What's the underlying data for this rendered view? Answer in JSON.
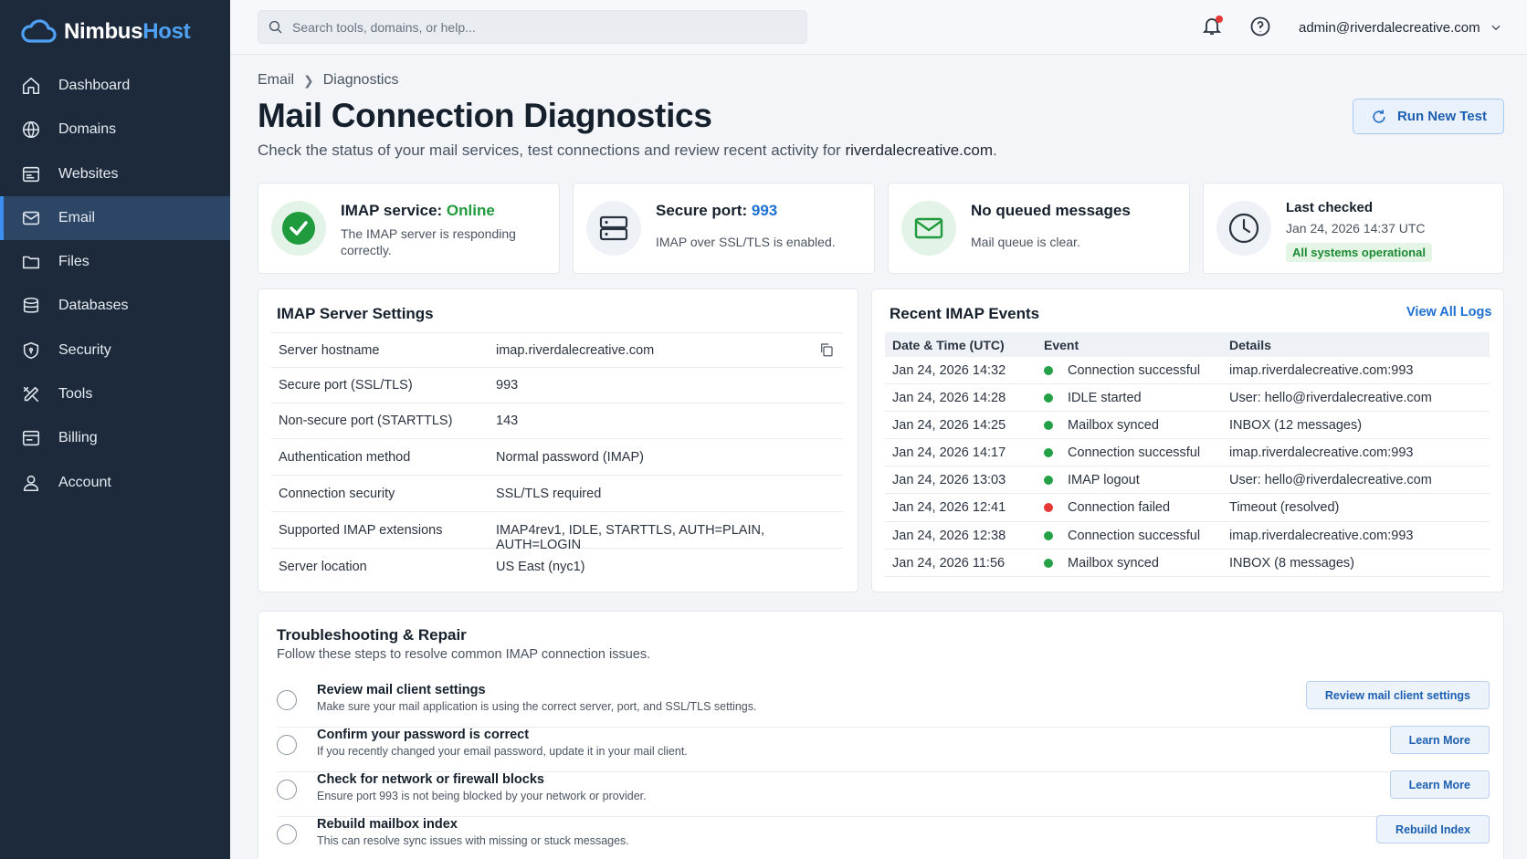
{
  "brand": {
    "name_a": "Nimbus",
    "name_b": "Host"
  },
  "sidebar": {
    "items": [
      {
        "label": "Dashboard",
        "icon": "home-icon"
      },
      {
        "label": "Domains",
        "icon": "globe-icon"
      },
      {
        "label": "Websites",
        "icon": "browser-window-icon"
      },
      {
        "label": "Email",
        "icon": "mail-icon",
        "active": true
      },
      {
        "label": "Files",
        "icon": "folder-icon"
      },
      {
        "label": "Databases",
        "icon": "database-icon"
      },
      {
        "label": "Security",
        "icon": "shield-icon"
      },
      {
        "label": "Tools",
        "icon": "tools-icon"
      },
      {
        "label": "Billing",
        "icon": "billing-icon"
      },
      {
        "label": "Account",
        "icon": "user-icon"
      }
    ]
  },
  "topbar": {
    "search_placeholder": "Search tools, domains, or help...",
    "user_email": "admin@riverdalecreative.com"
  },
  "breadcrumb": {
    "parent": "Email",
    "current": "Diagnostics"
  },
  "page": {
    "title": "Mail Connection Diagnostics",
    "subtitle_prefix": "Check the status of your mail services, test connections and review recent activity for ",
    "subtitle_domain": "riverdalecreative.com",
    "subtitle_suffix": ".",
    "run_button": "Run New Test"
  },
  "status_cards": {
    "imap": {
      "title_prefix": "IMAP service: ",
      "title_status": "Online",
      "desc": "The IMAP server is responding correctly."
    },
    "port": {
      "title_prefix": "Secure port: ",
      "title_value": "993",
      "desc": "IMAP over SSL/TLS is enabled."
    },
    "queue": {
      "title": "No queued messages",
      "desc": "Mail queue is clear."
    },
    "checked": {
      "title": "Last checked",
      "desc": "Jan 24, 2026 14:37 UTC",
      "badge": "All systems operational"
    }
  },
  "colors": {
    "accent": "#1d6fd1",
    "ok": "#24a146",
    "error": "#e53935",
    "sidebar": "#1d2a3b"
  },
  "settings": {
    "title": "IMAP Server Settings",
    "rows": [
      {
        "key": "Server hostname",
        "value": "imap.riverdalecreative.com"
      },
      {
        "key": "Secure port (SSL/TLS)",
        "value": "993"
      },
      {
        "key": "Non-secure port (STARTTLS)",
        "value": "143"
      },
      {
        "key": "Authentication method",
        "value": "Normal password (IMAP)"
      },
      {
        "key": "Connection security",
        "value": "SSL/TLS required"
      },
      {
        "key": "Supported IMAP extensions",
        "value": "IMAP4rev1, IDLE, STARTTLS, AUTH=PLAIN, AUTH=LOGIN"
      },
      {
        "key": "Server location",
        "value": "US East (nyc1)"
      }
    ]
  },
  "events": {
    "title": "Recent IMAP Events",
    "view_all": "View All Logs",
    "headers": [
      "Date & Time (UTC)",
      "Event",
      "Details"
    ],
    "rows": [
      {
        "time": "Jan 24, 2026 14:32",
        "status": "success",
        "event": "Connection successful",
        "details": "imap.riverdalecreative.com:993"
      },
      {
        "time": "Jan 24, 2026 14:28",
        "status": "success",
        "event": "IDLE started",
        "details": "User: hello@riverdalecreative.com"
      },
      {
        "time": "Jan 24, 2026 14:25",
        "status": "success",
        "event": "Mailbox synced",
        "details": "INBOX (12 messages)"
      },
      {
        "time": "Jan 24, 2026 14:17",
        "status": "success",
        "event": "Connection successful",
        "details": "imap.riverdalecreative.com:993"
      },
      {
        "time": "Jan 24, 2026 13:03",
        "status": "success",
        "event": "IMAP logout",
        "details": "User: hello@riverdalecreative.com"
      },
      {
        "time": "Jan 24, 2026 12:41",
        "status": "error",
        "event": "Connection failed",
        "details": "Timeout (resolved)"
      },
      {
        "time": "Jan 24, 2026 12:38",
        "status": "success",
        "event": "Connection successful",
        "details": "imap.riverdalecreative.com:993"
      },
      {
        "time": "Jan 24, 2026 11:56",
        "status": "success",
        "event": "Mailbox synced",
        "details": "INBOX (8 messages)"
      }
    ]
  },
  "troubleshooting": {
    "title": "Troubleshooting & Repair",
    "subtitle": "Follow these steps to resolve common IMAP connection issues.",
    "items": [
      {
        "title": "Review mail client settings",
        "desc": "Make sure your mail application is using the correct server, port, and SSL/TLS settings.",
        "button": "Review mail client settings"
      },
      {
        "title": "Confirm your password is correct",
        "desc": "If you recently changed your email password, update it in your mail client.",
        "button": "Learn More"
      },
      {
        "title": "Check for network or firewall blocks",
        "desc": "Ensure port 993 is not being blocked by your network or provider.",
        "button": "Learn More"
      },
      {
        "title": "Rebuild mailbox index",
        "desc": "This can resolve sync issues with missing or stuck messages.",
        "button": "Rebuild Index"
      }
    ]
  }
}
